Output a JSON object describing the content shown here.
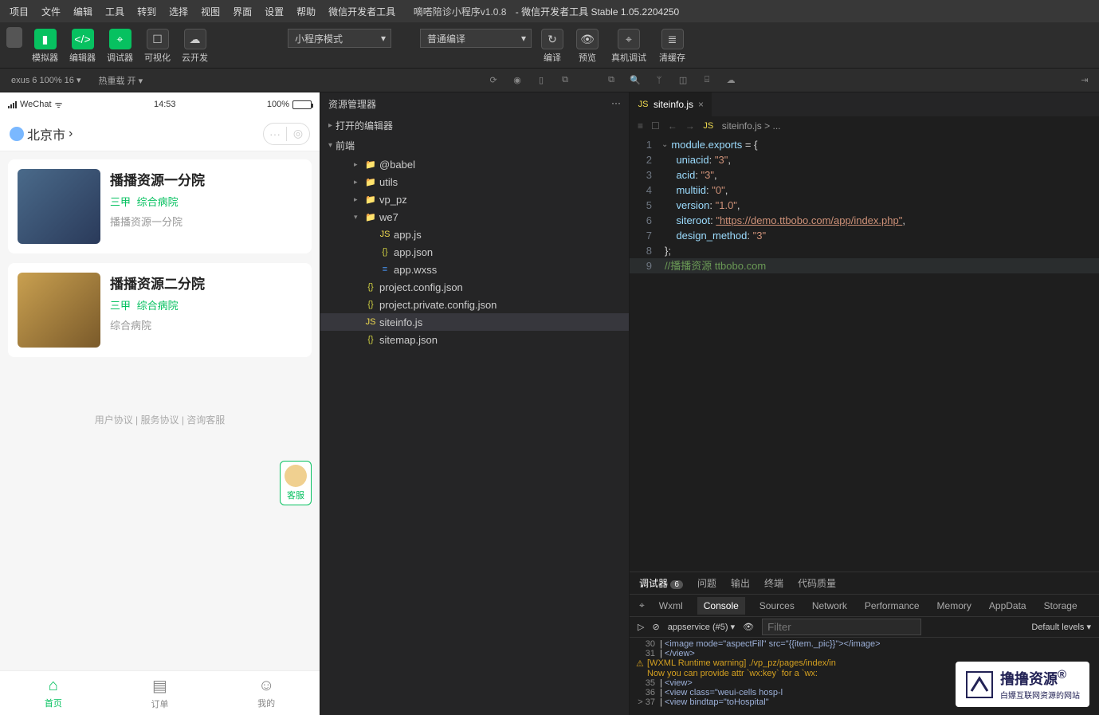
{
  "menu": [
    "项目",
    "文件",
    "编辑",
    "工具",
    "转到",
    "选择",
    "视图",
    "界面",
    "设置",
    "帮助",
    "微信开发者工具"
  ],
  "title": {
    "name": "嘀嗒陪诊小程序v1.0.8",
    "suffix": " - 微信开发者工具 Stable 1.05.2204250"
  },
  "toolbar": {
    "simulator": "模拟器",
    "editor": "编辑器",
    "debugger": "调试器",
    "visual": "可视化",
    "cloud": "云开发",
    "mode": "小程序模式",
    "compile_mode": "普通编译",
    "compile": "编译",
    "preview": "预览",
    "real": "真机调试",
    "clear": "清缓存"
  },
  "subbar": {
    "device": "exus 6 100% 16",
    "reload": "热重载 开"
  },
  "simulator": {
    "carrier": "WeChat",
    "time": "14:53",
    "battery": "100%",
    "location": "北京市",
    "hospitals": [
      {
        "name": "播播资源一分院",
        "level": "三甲",
        "type": "综合病院",
        "sub": "播播资源一分院"
      },
      {
        "name": "播播资源二分院",
        "level": "三甲",
        "type": "综合病院",
        "sub": "综合病院"
      }
    ],
    "links": "用户协议 | 服务协议 | 咨询客服",
    "kefu": "客服",
    "tabs": [
      "首页",
      "订单",
      "我的"
    ]
  },
  "explorer": {
    "title": "资源管理器",
    "s1": "打开的编辑器",
    "s2": "前端",
    "tree": [
      {
        "d": 1,
        "t": "folder",
        "n": "@babel",
        "closed": true
      },
      {
        "d": 1,
        "t": "folder",
        "n": "utils",
        "closed": true,
        "green": true
      },
      {
        "d": 1,
        "t": "folder",
        "n": "vp_pz",
        "closed": true
      },
      {
        "d": 1,
        "t": "folder",
        "n": "we7",
        "closed": false
      },
      {
        "d": 2,
        "t": "js",
        "n": "app.js"
      },
      {
        "d": 2,
        "t": "json",
        "n": "app.json"
      },
      {
        "d": 2,
        "t": "wxss",
        "n": "app.wxss"
      },
      {
        "d": 1,
        "t": "json",
        "n": "project.config.json"
      },
      {
        "d": 1,
        "t": "json",
        "n": "project.private.config.json"
      },
      {
        "d": 1,
        "t": "js",
        "n": "siteinfo.js",
        "sel": true
      },
      {
        "d": 1,
        "t": "json",
        "n": "sitemap.json"
      }
    ]
  },
  "editor": {
    "tab": "siteinfo.js",
    "crumb": "siteinfo.js > ...",
    "code": {
      "l1": "module.exports = {",
      "uniacid_k": "uniacid",
      "uniacid_v": "\"3\"",
      "acid_k": "acid",
      "acid_v": "\"3\"",
      "multiid_k": "multiid",
      "multiid_v": "\"0\"",
      "version_k": "version",
      "version_v": "\"1.0\"",
      "siteroot_k": "siteroot",
      "siteroot_v": "\"https://demo.ttbobo.com/app/index.php\"",
      "design_k": "design_method",
      "design_v": "\"3\"",
      "l8": "};",
      "l9": "//播播资源 ttbobo.com"
    }
  },
  "console": {
    "tabs": [
      "调试器",
      "问题",
      "输出",
      "终端",
      "代码质量"
    ],
    "badge": "6",
    "devtabs": [
      "Wxml",
      "Console",
      "Sources",
      "Network",
      "Performance",
      "Memory",
      "AppData",
      "Storage"
    ],
    "context": "appservice (#5)",
    "filter_ph": "Filter",
    "levels": "Default levels",
    "lines": {
      "l30": "<image mode=\"aspectFill\" src=\"{{item._pic}}\"></image>",
      "l31": "</view>",
      "warn": "[WXML Runtime warning] ./vp_pz/pages/index/in",
      "warn2": "Now you can provide attr `wx:key` for a `wx:",
      "l35": "<view>",
      "l36": "  <view class=\"weui-cells hosp-l",
      "l37": "    <view bindtap=\"toHospital\""
    }
  },
  "watermark": {
    "brand": "撸撸资源",
    "sub": "白嫖互联网资源的网站",
    "r": "®"
  }
}
